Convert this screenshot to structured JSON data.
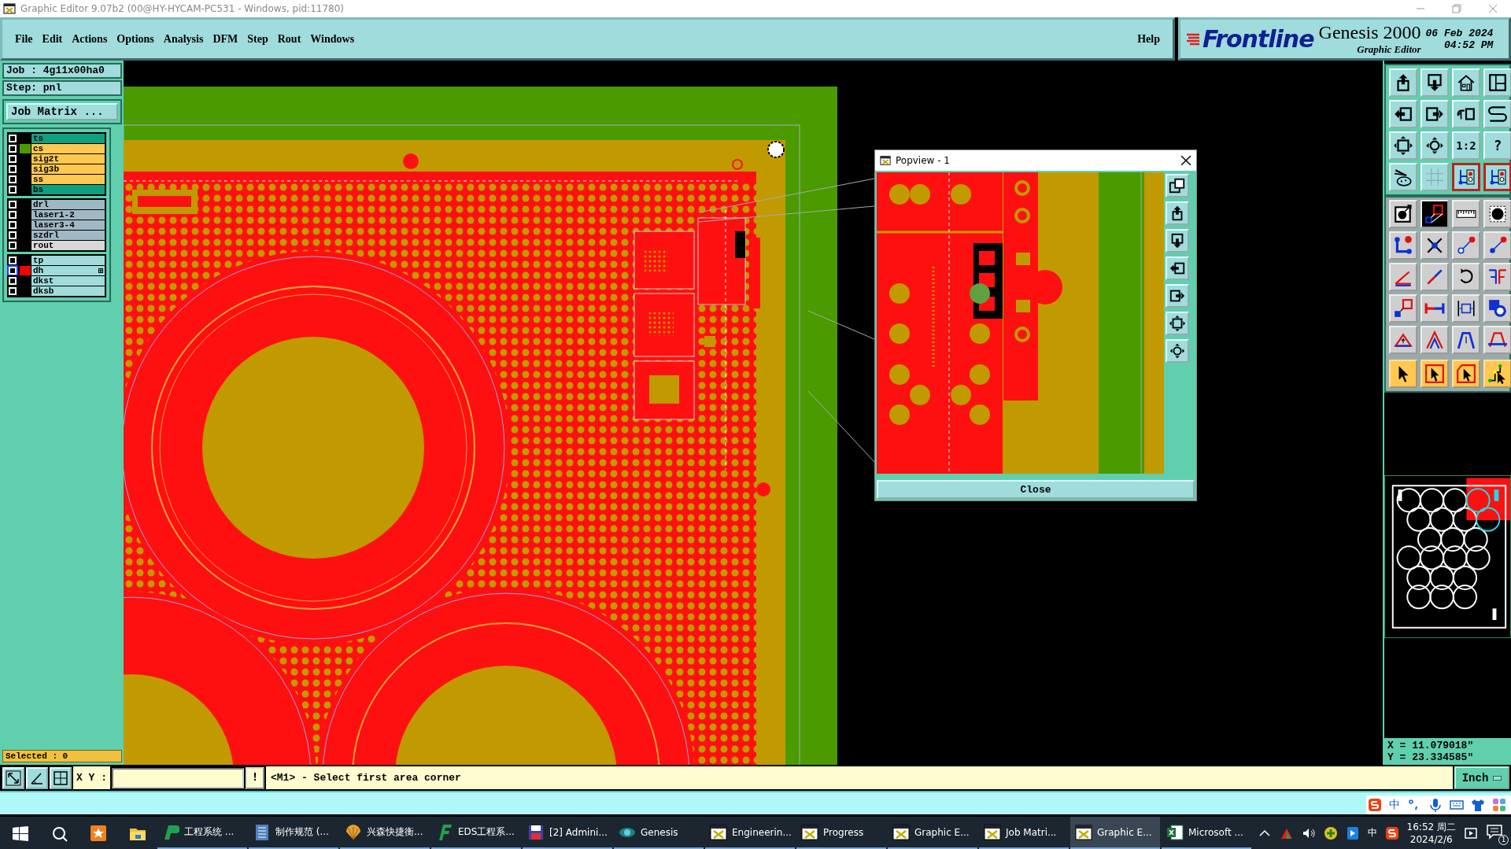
{
  "window": {
    "title": "Graphic Editor 9.07b2 (00@HY-HYCAM-PC531 - Windows, pid:11780)"
  },
  "menu": [
    {
      "label": "File"
    },
    {
      "label": "Edit"
    },
    {
      "label": "Actions"
    },
    {
      "label": "Options"
    },
    {
      "label": "Analysis"
    },
    {
      "label": "DFM"
    },
    {
      "label": "Step"
    },
    {
      "label": "Rout"
    },
    {
      "label": "Windows"
    }
  ],
  "help": "Help",
  "brand": {
    "logo": "Frontline",
    "product": "Genesis 2000",
    "subtitle": "Graphic Editor",
    "date": "06 Feb 2024",
    "time": "04:52 PM"
  },
  "job": "Job : 4g11x00ha0",
  "step": "Step: pnl",
  "job_matrix_button": "Job Matrix ...",
  "layer_groups": [
    {
      "layers": [
        {
          "name": "ts",
          "color": "#10a080",
          "checked": false,
          "selected": false,
          "has_attributes": false
        },
        {
          "name": "cs",
          "color": "#ffc850",
          "checked": false,
          "selected": false,
          "swatch": {
            "color": "#4a9a00"
          },
          "has_attributes": false
        },
        {
          "name": "sig2t",
          "color": "#ffc850",
          "checked": false,
          "selected": false,
          "has_attributes": false
        },
        {
          "name": "sig3b",
          "color": "#ffc850",
          "checked": false,
          "selected": false,
          "has_attributes": false
        },
        {
          "name": "ss",
          "color": "#ffc850",
          "checked": false,
          "selected": false,
          "has_attributes": false
        },
        {
          "name": "bs",
          "color": "#10a080",
          "checked": false,
          "selected": false,
          "has_attributes": false
        }
      ]
    },
    {
      "layers": [
        {
          "name": "drl",
          "color": "#a0b8c4",
          "checked": false,
          "selected": false,
          "has_attributes": false
        },
        {
          "name": "laser1-2",
          "color": "#a0b8c4",
          "checked": false,
          "selected": false,
          "has_attributes": false
        },
        {
          "name": "laser3-4",
          "color": "#a0b8c4",
          "checked": false,
          "selected": false,
          "has_attributes": false
        },
        {
          "name": "szdrl",
          "color": "#a0b8c4",
          "checked": false,
          "selected": false,
          "has_attributes": false
        },
        {
          "name": "rout",
          "color": "#d8d8d8",
          "checked": false,
          "selected": false,
          "has_attributes": false
        }
      ]
    },
    {
      "layers": [
        {
          "name": "tp",
          "color": "#a0dcdc",
          "checked": false,
          "selected": false,
          "has_attributes": false
        },
        {
          "name": "dh",
          "color": "#a0dcdc",
          "checked": false,
          "selected": true,
          "swatch": {
            "color": "#ff0000"
          },
          "has_attributes": true
        },
        {
          "name": "dkst",
          "color": "#a0dcdc",
          "checked": false,
          "selected": false,
          "has_attributes": false
        },
        {
          "name": "dksb",
          "color": "#a0dcdc",
          "checked": false,
          "selected": false,
          "has_attributes": false
        }
      ]
    }
  ],
  "selected_count": "Selected : 0",
  "popview": {
    "title": "Popview - 1",
    "close_button": "Close",
    "tools": [
      {
        "kind": "copy"
      },
      {
        "kind": "up"
      },
      {
        "kind": "down"
      },
      {
        "kind": "left"
      },
      {
        "kind": "right"
      },
      {
        "kind": "fit"
      },
      {
        "kind": "center"
      }
    ]
  },
  "tool_groups": [
    {
      "tools": [
        {
          "kind": "up",
          "on": false
        },
        {
          "kind": "down",
          "on": false
        },
        {
          "kind": "home",
          "on": false
        },
        {
          "kind": "window",
          "on": false
        },
        {
          "kind": "left",
          "on": false
        },
        {
          "kind": "right",
          "on": false
        },
        {
          "kind": "undo",
          "on": false
        },
        {
          "kind": "redraw",
          "on": false
        },
        {
          "kind": "fit",
          "on": false
        },
        {
          "kind": "center",
          "on": false
        },
        {
          "kind": "scale",
          "label": "1:2",
          "on": false
        },
        {
          "kind": "help",
          "label": "?",
          "on": false
        },
        {
          "kind": "tools",
          "on": false
        },
        {
          "kind": "grid",
          "on": false
        },
        {
          "kind": "net",
          "on": true
        },
        {
          "kind": "net",
          "on": true
        }
      ]
    },
    {
      "tools": [
        {
          "kind": "snap",
          "on": false
        },
        {
          "kind": "zoom_box",
          "on": true
        },
        {
          "kind": "ruler",
          "on": false
        },
        {
          "kind": "pad",
          "on": false
        },
        {
          "kind": "connect",
          "on": false
        },
        {
          "kind": "cross",
          "on": false
        },
        {
          "kind": "add_point",
          "on": false
        },
        {
          "kind": "move_point",
          "on": false
        },
        {
          "kind": "angle",
          "on": false
        },
        {
          "kind": "line",
          "on": false
        },
        {
          "kind": "rotate",
          "on": false
        },
        {
          "kind": "mirror",
          "on": false
        },
        {
          "kind": "resize",
          "on": false
        },
        {
          "kind": "split",
          "on": false
        },
        {
          "kind": "stretch",
          "on": false
        },
        {
          "kind": "merge",
          "on": false
        },
        {
          "kind": "tri_a",
          "on": false
        },
        {
          "kind": "tri_b",
          "on": false
        },
        {
          "kind": "tri_c",
          "on": false
        },
        {
          "kind": "tri_d",
          "on": false
        }
      ]
    },
    {
      "tools": [
        {
          "kind": "pick",
          "on": false
        },
        {
          "kind": "pick_box",
          "on": false
        },
        {
          "kind": "pick_poly",
          "on": false
        },
        {
          "kind": "pick_net",
          "on": false
        }
      ]
    }
  ],
  "coordinates": {
    "x": "X = 11.079018\"",
    "y": "Y = 23.334585\""
  },
  "status": {
    "xy_label": "X Y :",
    "alert_button": "!",
    "prompt": "<M1> - Select first area corner",
    "units": "Inch"
  },
  "ime": {
    "mode": "中"
  },
  "taskbar": {
    "apps": [
      {
        "label": "工程系统 ...",
        "kind": "p",
        "selected": false
      },
      {
        "label": "制作规范 (...",
        "kind": "doc",
        "selected": false
      },
      {
        "label": "兴森快捷衡...",
        "kind": "shell",
        "selected": false
      },
      {
        "label": "EDS工程系...",
        "kind": "f",
        "selected": false
      },
      {
        "label": "[2] Admini...",
        "kind": "floppy",
        "selected": false
      },
      {
        "label": "Genesis",
        "kind": "genesis",
        "selected": false
      },
      {
        "label": "Engineerin...",
        "kind": "xwin",
        "selected": false
      },
      {
        "label": "Progress",
        "kind": "xwin",
        "selected": false
      },
      {
        "label": "Graphic E...",
        "kind": "xwin",
        "selected": false
      },
      {
        "label": "Job Matri...",
        "kind": "xwin",
        "selected": false
      },
      {
        "label": "Graphic E...",
        "kind": "xwin",
        "selected": true
      },
      {
        "label": "Microsoft ...",
        "kind": "excel",
        "selected": false
      }
    ],
    "tray_language": "中",
    "clock_time": "16:52 周二",
    "clock_date": "2024/2/6",
    "notifications": "1"
  }
}
